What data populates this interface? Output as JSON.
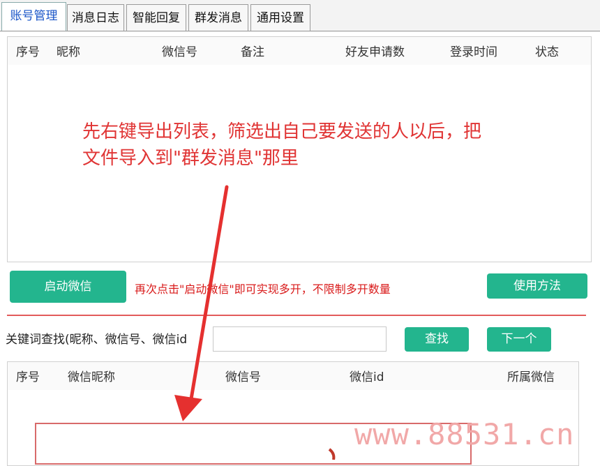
{
  "tabs": [
    {
      "label": "账号管理",
      "active": true
    },
    {
      "label": "消息日志",
      "active": false
    },
    {
      "label": "智能回复",
      "active": false
    },
    {
      "label": "群发消息",
      "active": false
    },
    {
      "label": "通用设置",
      "active": false
    }
  ],
  "account_table": {
    "columns": [
      "序号",
      "昵称",
      "微信号",
      "备注",
      "好友申请数",
      "登录时间",
      "状态"
    ]
  },
  "annotation": {
    "line1": "先右键导出列表，筛选出自己要发送的人以后，把",
    "line2": "文件导入到\"群发消息\"那里"
  },
  "actions": {
    "start_wechat": "启动微信",
    "hint": "再次点击\"启动微信\"即可实现多开，不限制多开数量",
    "usage": "使用方法"
  },
  "search": {
    "label": "关键词查找(昵称、微信号、微信id",
    "value": "",
    "find_button": "查找",
    "next_button": "下一个"
  },
  "result_table": {
    "columns": [
      "序号",
      "微信昵称",
      "微信号",
      "微信id",
      "所属微信"
    ]
  },
  "watermark": "www.88531.cn",
  "colors": {
    "accent_green": "#23b58e",
    "annotation_red": "#e03434",
    "active_tab_text": "#1a55c8"
  }
}
